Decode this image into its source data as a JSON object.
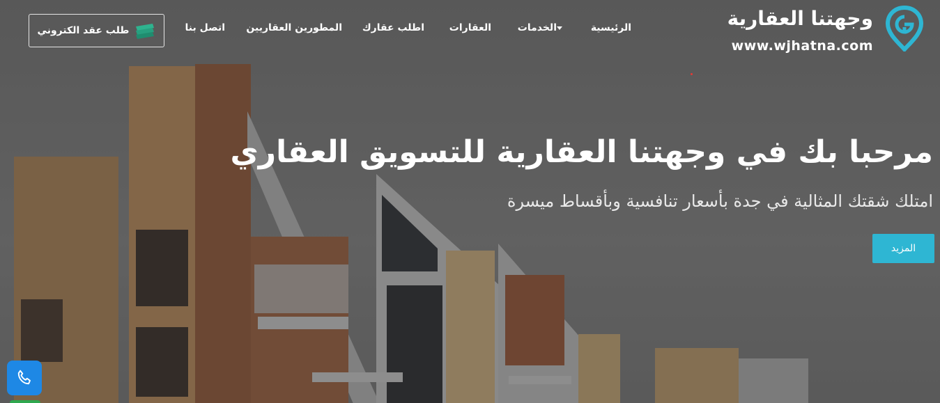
{
  "brand": {
    "title": "وجهتنا العقارية",
    "url": "www.wjhatna.com",
    "accent_color": "#2eb6d3"
  },
  "nav": {
    "items": [
      {
        "label": "الرئيسية"
      },
      {
        "label": "الخدمات",
        "has_dropdown": true
      },
      {
        "label": "العقارات"
      },
      {
        "label": "اطلب عقارك"
      },
      {
        "label": "المطورين العقاريين"
      },
      {
        "label": "اتصل بنا"
      }
    ],
    "contract_button": "طلب عقد الكتروني"
  },
  "hero": {
    "title": "مرحبا بك في وجهتنا العقارية للتسويق العقاري",
    "subtitle": "امتلك شقتك المثالية في جدة بأسعار تنافسية وبأقساط ميسرة",
    "more_button": "المزيد"
  },
  "floating": {
    "phone_icon": "phone-icon",
    "phone_color": "#1e88e5"
  }
}
